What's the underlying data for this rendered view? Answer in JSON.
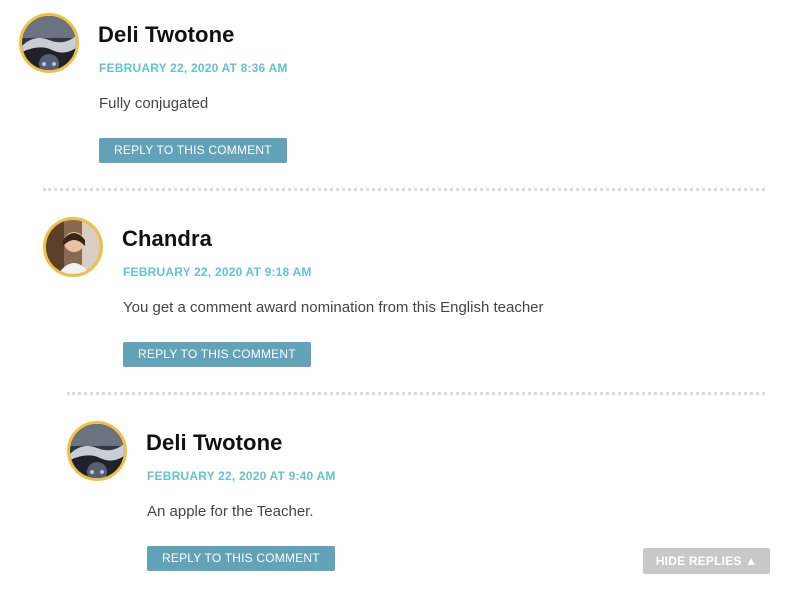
{
  "comments": [
    {
      "author": "Deli Twotone",
      "date": "FEBRUARY 22, 2020 AT 8:36 AM",
      "text": "Fully conjugated",
      "reply_label": "REPLY TO THIS COMMENT"
    },
    {
      "author": "Chandra",
      "date": "FEBRUARY 22, 2020 AT 9:18 AM",
      "text": "You get a comment award nomination from this English teacher",
      "reply_label": "REPLY TO THIS COMMENT"
    },
    {
      "author": "Deli Twotone",
      "date": "FEBRUARY 22, 2020 AT 9:40 AM",
      "text": "An apple for the Teacher.",
      "reply_label": "REPLY TO THIS COMMENT"
    }
  ],
  "hide_replies_label": "HIDE REPLIES ▲",
  "colors": {
    "avatar_border": "#f0c043",
    "date": "#64c3cc",
    "reply_button": "#62a3ba",
    "hide_replies_button": "#c8c8c8"
  }
}
